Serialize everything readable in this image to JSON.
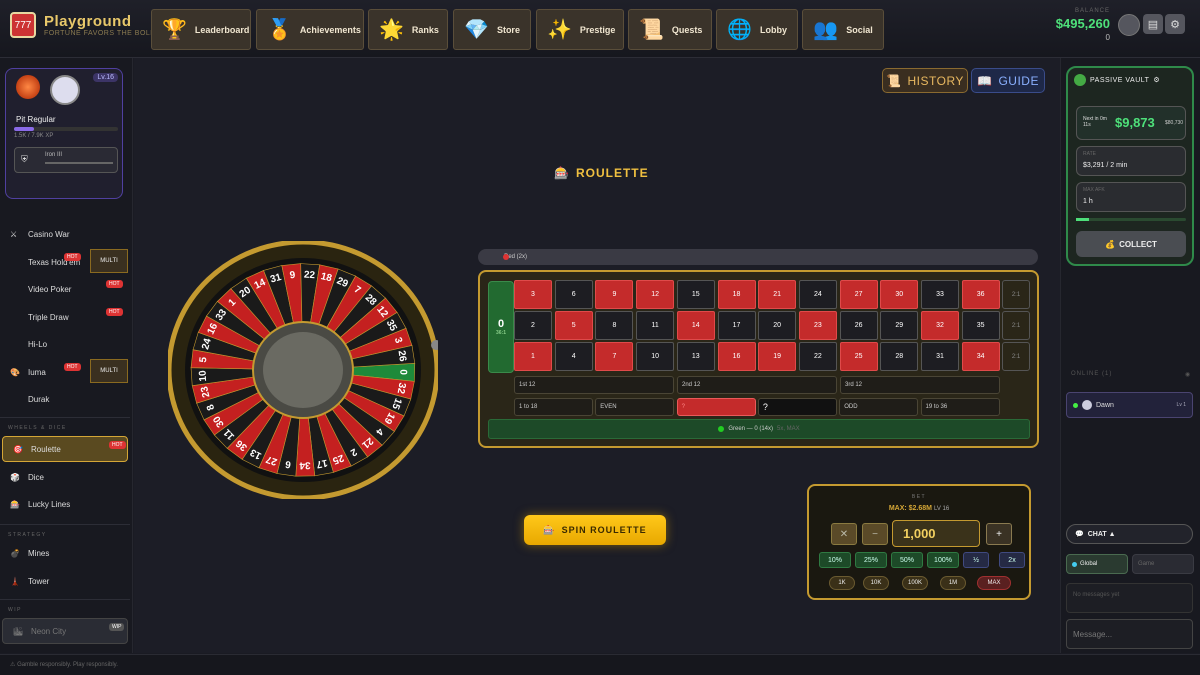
{
  "app": {
    "name": "Playground",
    "tagline": "FORTUNE FAVORS THE BOLD"
  },
  "nav": [
    {
      "label": "Leaderboard",
      "icon": "trophy-icon",
      "glyph": "🏆"
    },
    {
      "label": "Achievements",
      "icon": "medal-icon",
      "glyph": "🏅"
    },
    {
      "label": "Ranks",
      "icon": "sun-badge-icon",
      "glyph": "🌟"
    },
    {
      "label": "Store",
      "icon": "diamond-icon",
      "glyph": "💎"
    },
    {
      "label": "Prestige",
      "icon": "sparkles-icon",
      "glyph": "✨"
    },
    {
      "label": "Quests",
      "icon": "scroll-icon",
      "glyph": "📜"
    },
    {
      "label": "Lobby",
      "icon": "globe-icon",
      "glyph": "🌐"
    },
    {
      "label": "Social",
      "icon": "people-icon",
      "glyph": "👥"
    }
  ],
  "balance": {
    "label": "BALANCE",
    "value": "$495,260",
    "sub": "0"
  },
  "profile": {
    "level": "Lv.16",
    "title": "Pit Regular",
    "xp": "1.5K / 7.9K XP",
    "xp_fraction": 0.19,
    "rank": "Iron III"
  },
  "sidebar": {
    "items": [
      {
        "label": "Casino War",
        "icon": "swords-icon",
        "glyph": "⚔"
      },
      {
        "label": "Texas Hold'em",
        "icon": "cards-icon",
        "glyph": "",
        "hot": "HOT",
        "multi": "MULTI"
      },
      {
        "label": "Video Poker",
        "icon": "poker-icon",
        "glyph": "",
        "hot": "HOT"
      },
      {
        "label": "Triple Draw",
        "icon": "draw-icon",
        "glyph": "",
        "hot": "HOT"
      },
      {
        "label": "Hi-Lo",
        "icon": "hilo-icon",
        "glyph": ""
      },
      {
        "label": "Iuma",
        "icon": "iuma-icon",
        "glyph": "🎨",
        "hot": "HOT",
        "multi": "MULTI"
      },
      {
        "label": "Durak",
        "icon": "durak-icon",
        "glyph": ""
      }
    ],
    "section_wheels": "WHEELS & DICE",
    "wheels": [
      {
        "label": "Roulette",
        "icon": "roulette-icon",
        "glyph": "🎯",
        "hot": "HOT"
      },
      {
        "label": "Dice",
        "icon": "dice-icon",
        "glyph": "🎲"
      },
      {
        "label": "Lucky Lines",
        "icon": "lucky-lines-icon",
        "glyph": "🎰"
      }
    ],
    "section_strategy": "STRATEGY",
    "strategy": [
      {
        "label": "Mines",
        "icon": "mine-icon",
        "glyph": "💣"
      },
      {
        "label": "Tower",
        "icon": "tower-icon",
        "glyph": "🗼"
      }
    ],
    "section_wip": "WIP",
    "wip": [
      {
        "label": "Neon City",
        "icon": "city-icon",
        "glyph": "🏙",
        "badge": "WIP"
      }
    ]
  },
  "main": {
    "history": "HISTORY",
    "guide": "GUIDE",
    "title": "ROULETTE",
    "last_result": "Red (2x)",
    "zero": "0",
    "zero_sub": "36:1",
    "rows": [
      [
        "3",
        "6",
        "9",
        "12",
        "15",
        "18",
        "21",
        "24",
        "27",
        "30",
        "33",
        "36"
      ],
      [
        "2",
        "5",
        "8",
        "11",
        "14",
        "17",
        "20",
        "23",
        "26",
        "29",
        "32",
        "35"
      ],
      [
        "1",
        "4",
        "7",
        "10",
        "13",
        "16",
        "19",
        "22",
        "25",
        "28",
        "31",
        "34"
      ]
    ],
    "reds": [
      "1",
      "3",
      "5",
      "7",
      "9",
      "12",
      "14",
      "16",
      "18",
      "19",
      "21",
      "23",
      "25",
      "27",
      "30",
      "32",
      "34",
      "36"
    ],
    "column_labels": [
      "2:1",
      "2:1",
      "2:1"
    ],
    "dozens": [
      "1st 12",
      "2nd 12",
      "3rd 12"
    ],
    "outside": [
      "1 to 18",
      "EVEN",
      "?",
      "?",
      "ODD",
      "19 to 36"
    ],
    "green_bet": "Green — 0 (14x)",
    "green_sub": "5x, MAX",
    "wheel_numbers": [
      "0",
      "32",
      "15",
      "19",
      "4",
      "21",
      "2",
      "25",
      "17",
      "34",
      "6",
      "27",
      "13",
      "36",
      "11",
      "30",
      "8",
      "23",
      "10",
      "5",
      "24",
      "16",
      "33",
      "1",
      "20",
      "14",
      "31",
      "9",
      "22",
      "18",
      "29",
      "7",
      "28",
      "12",
      "35",
      "3",
      "26"
    ],
    "spin": "SPIN ROULETTE"
  },
  "bet": {
    "label": "BET",
    "max": "MAX: $2.68M",
    "lv": "LV 16",
    "value": "1,000",
    "clear": "✕",
    "minus": "−",
    "plus": "+",
    "pcts": [
      "10%",
      "25%",
      "50%",
      "100%",
      "½",
      "2x"
    ],
    "amounts": [
      "1K",
      "10K",
      "100K",
      "1M",
      "MAX"
    ]
  },
  "vault": {
    "title": "PASSIVE VAULT",
    "next": "Next in 0m 11s",
    "amount": "$9,873",
    "cap": "$80,730",
    "rate_label": "RATE",
    "rate": "$3,291 / 2 min",
    "max_label": "MAX AFK",
    "max": "1 h",
    "fill_fraction": 0.12,
    "collect": "COLLECT"
  },
  "online": {
    "label": "ONLINE (1)",
    "users": [
      {
        "name": "Dawn",
        "level": "Lv 1"
      }
    ]
  },
  "chat": {
    "title": "CHAT ▲",
    "tabs": [
      "Global",
      "Game"
    ],
    "empty": "No messages yet",
    "placeholder": "Message..."
  },
  "footer": {
    "text": "Gamble responsibly. Play responsibly."
  },
  "colors": {
    "accent": "#f0c040",
    "green": "#4ee07a",
    "red": "#c42b2b"
  }
}
